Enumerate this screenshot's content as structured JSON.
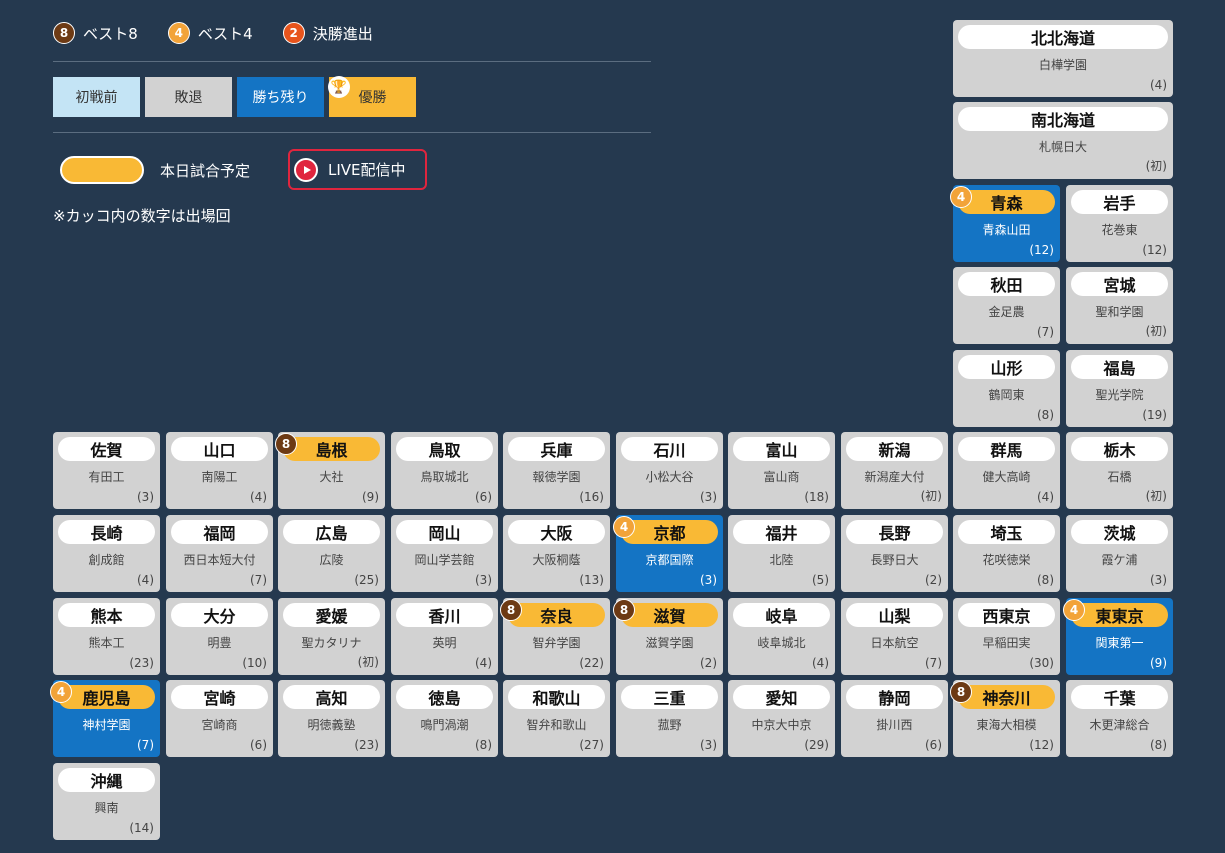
{
  "legend": {
    "badges": [
      {
        "num": "8",
        "label": "ベスト8"
      },
      {
        "num": "4",
        "label": "ベスト4"
      },
      {
        "num": "2",
        "label": "決勝進出"
      }
    ],
    "statuses": {
      "pre": "初戦前",
      "lose": "敗退",
      "alive": "勝ち残り",
      "win": "優勝"
    },
    "today": "本日試合予定",
    "live": "LIVE配信中",
    "note": "※カッコ内の数字は出場回"
  },
  "colors": {
    "background": "#25394f",
    "alive": "#1474c4",
    "today": "#f9b935",
    "best8": "#6d3a14",
    "best4": "#f2a339",
    "final": "#e8541c",
    "live": "#e0253e"
  },
  "cards": [
    {
      "pref": "北北海道",
      "school": "白樺学園",
      "count": "(4)"
    },
    {
      "pref": "南北海道",
      "school": "札幌日大",
      "count": "(初)"
    },
    {
      "pref": "青森",
      "school": "青森山田",
      "count": "(12)",
      "badge": "4",
      "state": "alive",
      "today": true
    },
    {
      "pref": "岩手",
      "school": "花巻東",
      "count": "(12)"
    },
    {
      "pref": "秋田",
      "school": "金足農",
      "count": "(7)"
    },
    {
      "pref": "宮城",
      "school": "聖和学園",
      "count": "(初)"
    },
    {
      "pref": "山形",
      "school": "鶴岡東",
      "count": "(8)"
    },
    {
      "pref": "福島",
      "school": "聖光学院",
      "count": "(19)"
    },
    {
      "pref": "佐賀",
      "school": "有田工",
      "count": "(3)"
    },
    {
      "pref": "山口",
      "school": "南陽工",
      "count": "(4)"
    },
    {
      "pref": "島根",
      "school": "大社",
      "count": "(9)",
      "badge": "8",
      "today": true
    },
    {
      "pref": "鳥取",
      "school": "鳥取城北",
      "count": "(6)"
    },
    {
      "pref": "兵庫",
      "school": "報徳学園",
      "count": "(16)"
    },
    {
      "pref": "石川",
      "school": "小松大谷",
      "count": "(3)"
    },
    {
      "pref": "富山",
      "school": "富山商",
      "count": "(18)"
    },
    {
      "pref": "新潟",
      "school": "新潟産大付",
      "count": "(初)"
    },
    {
      "pref": "群馬",
      "school": "健大高崎",
      "count": "(4)"
    },
    {
      "pref": "栃木",
      "school": "石橋",
      "count": "(初)"
    },
    {
      "pref": "長崎",
      "school": "創成館",
      "count": "(4)"
    },
    {
      "pref": "福岡",
      "school": "西日本短大付",
      "count": "(7)"
    },
    {
      "pref": "広島",
      "school": "広陵",
      "count": "(25)"
    },
    {
      "pref": "岡山",
      "school": "岡山学芸館",
      "count": "(3)"
    },
    {
      "pref": "大阪",
      "school": "大阪桐蔭",
      "count": "(13)"
    },
    {
      "pref": "京都",
      "school": "京都国際",
      "count": "(3)",
      "badge": "4",
      "state": "alive",
      "today": true
    },
    {
      "pref": "福井",
      "school": "北陸",
      "count": "(5)"
    },
    {
      "pref": "長野",
      "school": "長野日大",
      "count": "(2)"
    },
    {
      "pref": "埼玉",
      "school": "花咲徳栄",
      "count": "(8)"
    },
    {
      "pref": "茨城",
      "school": "霞ケ浦",
      "count": "(3)"
    },
    {
      "pref": "熊本",
      "school": "熊本工",
      "count": "(23)"
    },
    {
      "pref": "大分",
      "school": "明豊",
      "count": "(10)"
    },
    {
      "pref": "愛媛",
      "school": "聖カタリナ",
      "count": "(初)"
    },
    {
      "pref": "香川",
      "school": "英明",
      "count": "(4)"
    },
    {
      "pref": "奈良",
      "school": "智弁学園",
      "count": "(22)",
      "badge": "8",
      "today": true
    },
    {
      "pref": "滋賀",
      "school": "滋賀学園",
      "count": "(2)",
      "badge": "8",
      "today": true
    },
    {
      "pref": "岐阜",
      "school": "岐阜城北",
      "count": "(4)"
    },
    {
      "pref": "山梨",
      "school": "日本航空",
      "count": "(7)"
    },
    {
      "pref": "西東京",
      "school": "早稲田実",
      "count": "(30)"
    },
    {
      "pref": "東東京",
      "school": "関東第一",
      "count": "(9)",
      "badge": "4",
      "state": "alive",
      "today": true
    },
    {
      "pref": "鹿児島",
      "school": "神村学園",
      "count": "(7)",
      "badge": "4",
      "state": "alive",
      "today": true
    },
    {
      "pref": "宮崎",
      "school": "宮崎商",
      "count": "(6)"
    },
    {
      "pref": "高知",
      "school": "明徳義塾",
      "count": "(23)"
    },
    {
      "pref": "徳島",
      "school": "鳴門渦潮",
      "count": "(8)"
    },
    {
      "pref": "和歌山",
      "school": "智弁和歌山",
      "count": "(27)"
    },
    {
      "pref": "三重",
      "school": "菰野",
      "count": "(3)"
    },
    {
      "pref": "愛知",
      "school": "中京大中京",
      "count": "(29)"
    },
    {
      "pref": "静岡",
      "school": "掛川西",
      "count": "(6)"
    },
    {
      "pref": "神奈川",
      "school": "東海大相模",
      "count": "(12)",
      "badge": "8",
      "today": true
    },
    {
      "pref": "千葉",
      "school": "木更津総合",
      "count": "(8)"
    },
    {
      "pref": "沖縄",
      "school": "興南",
      "count": "(14)"
    }
  ]
}
